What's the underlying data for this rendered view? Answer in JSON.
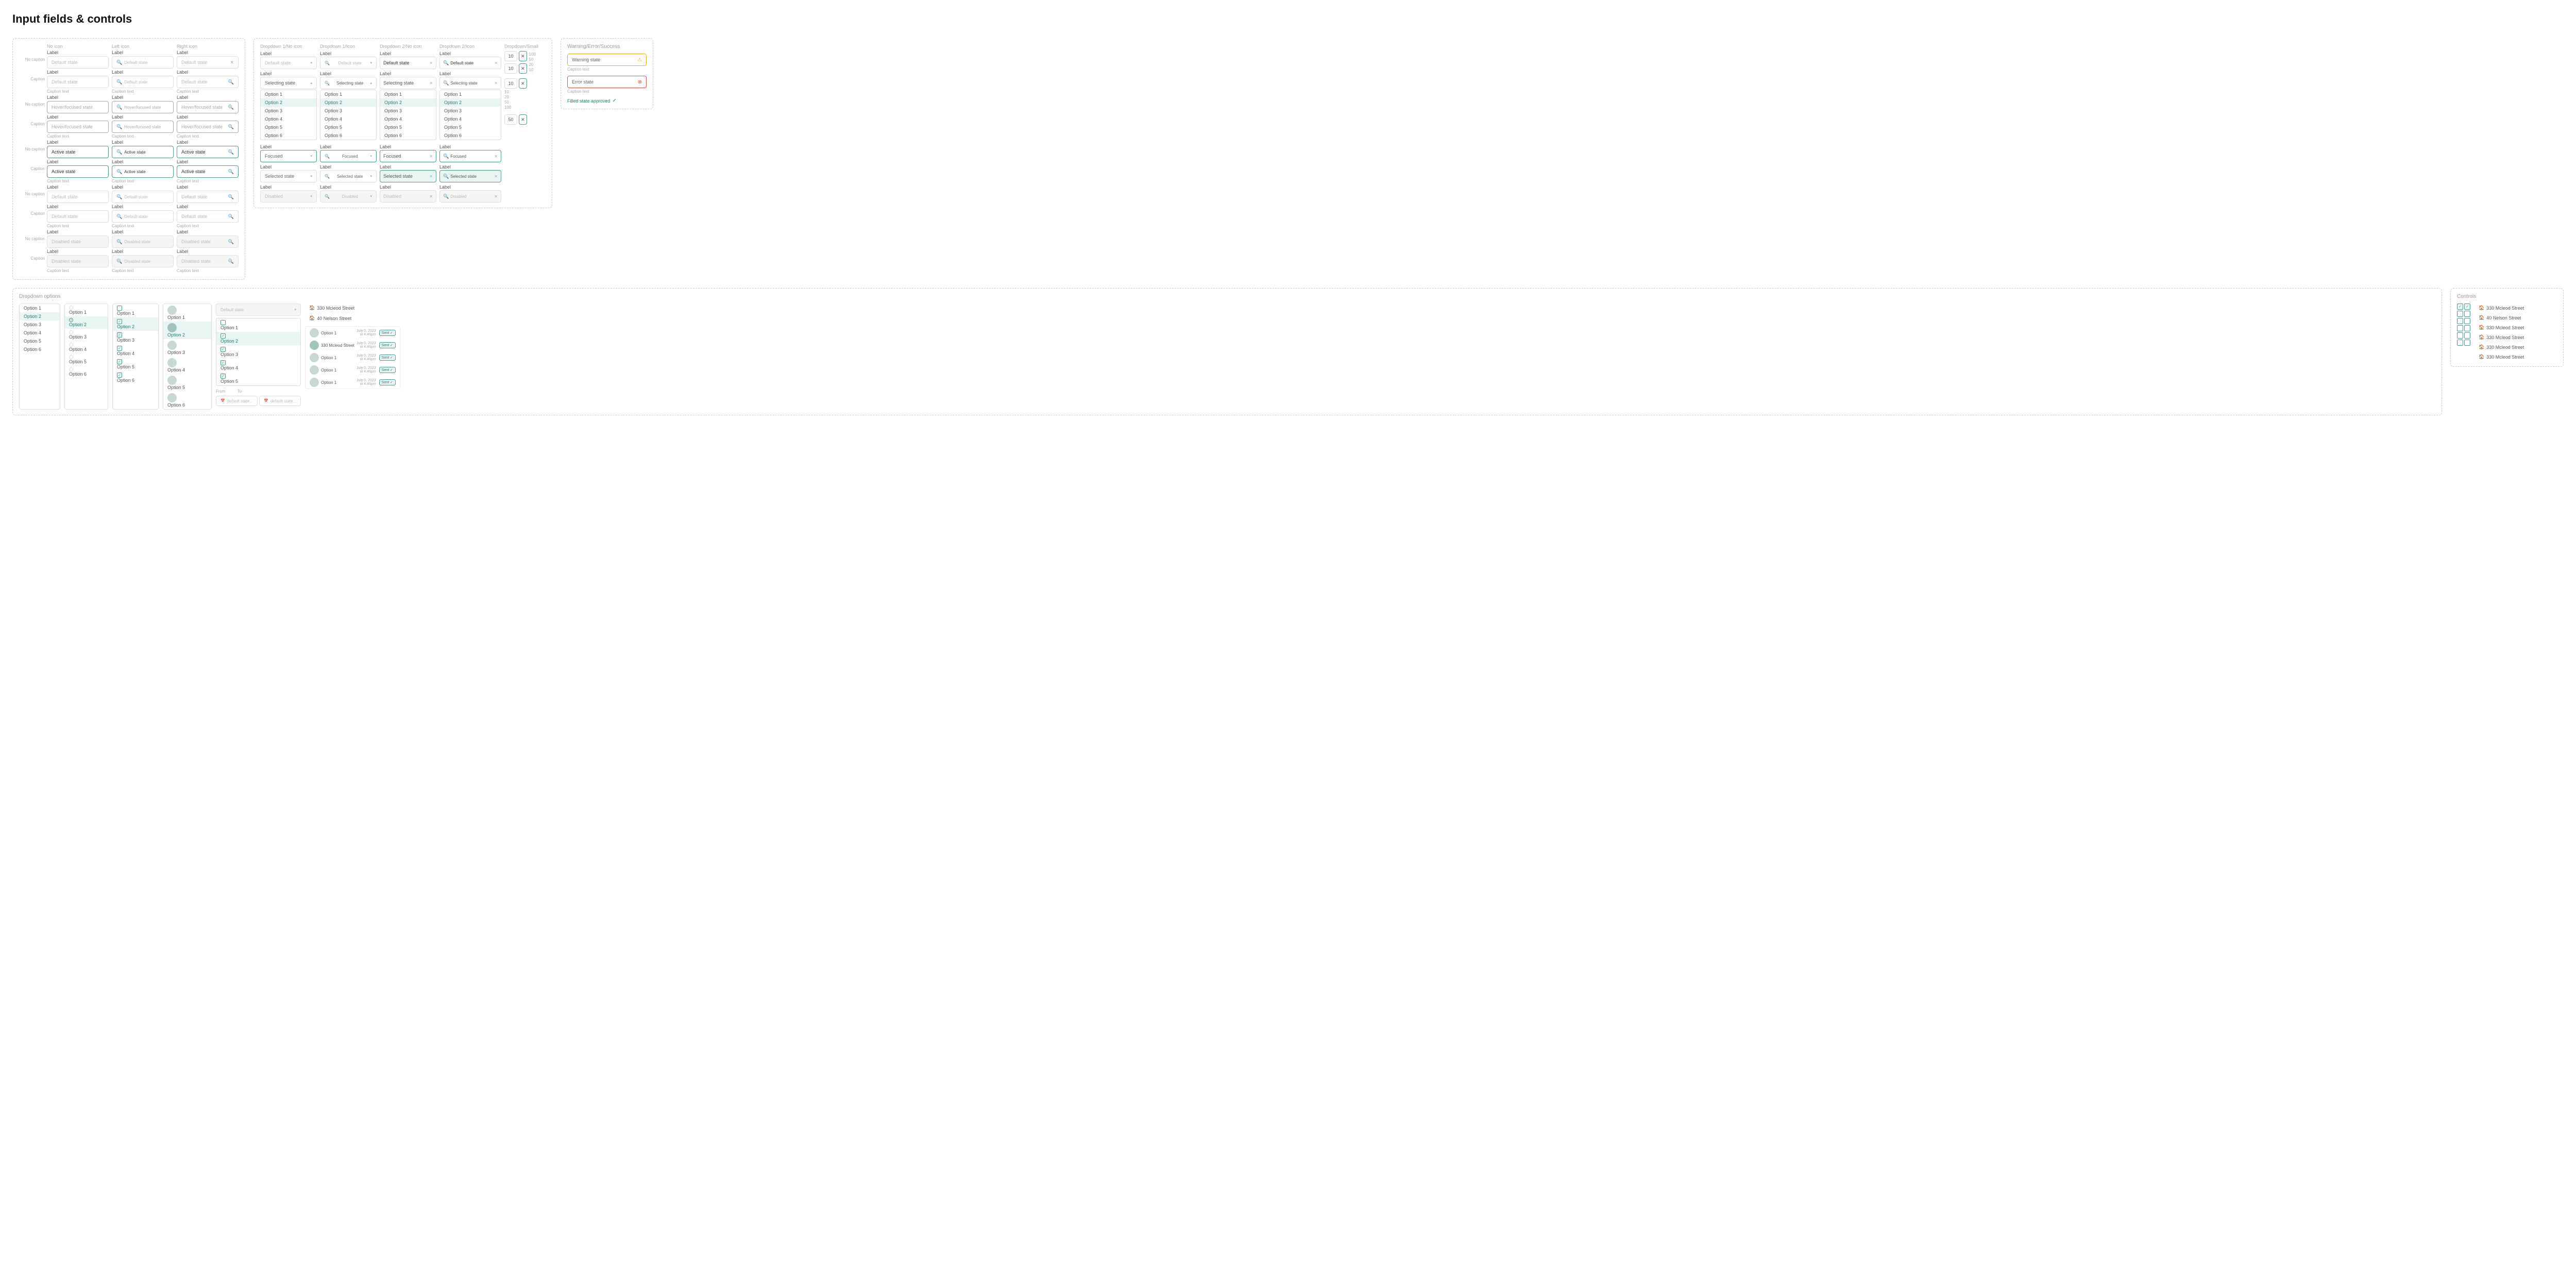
{
  "page": {
    "title": "Input fields & controls"
  },
  "inputSection": {
    "title": "",
    "columns": {
      "noIcon": "No icon",
      "leftIcon": "Left icon",
      "rightIcon": "Right icon"
    },
    "rows": [
      {
        "rowLabel1": "No caption",
        "rowLabel2": "Caption",
        "label": "Label",
        "states": [
          {
            "name": "default",
            "placeholder": "Default state",
            "caption": null
          },
          {
            "name": "hover",
            "placeholder": "Hover/focused state",
            "caption": null
          },
          {
            "name": "active",
            "placeholder": "Active state",
            "caption": null
          },
          {
            "name": "default2",
            "placeholder": "Default state",
            "caption": null
          },
          {
            "name": "disabled",
            "placeholder": "Disabled state",
            "caption": null
          }
        ]
      }
    ],
    "captionText": "Caption text"
  },
  "dropdownSection": {
    "columns": [
      "Dropdown 1/No icon",
      "Dropdown 1/Icon",
      "Dropdown 2/No icon",
      "Dropdown 2/Icon",
      "Dropdown/Small"
    ],
    "states": [
      {
        "label": "Label",
        "value": "Default state",
        "type": "default"
      },
      {
        "label": "Label",
        "value": "Selecting state",
        "type": "selecting"
      },
      {
        "label": "Label",
        "value": "Focused",
        "type": "focused"
      },
      {
        "label": "Label",
        "value": "Selected state",
        "type": "selected"
      },
      {
        "label": "Label",
        "value": "Disabled",
        "type": "disabled"
      }
    ],
    "options": [
      "Option 1",
      "Option 2",
      "Option 3",
      "Option 4",
      "Option 5",
      "Option 6"
    ],
    "smallNumbers": [
      "100",
      "50",
      "20",
      "10",
      "10",
      "20",
      "50",
      "100"
    ]
  },
  "warningSection": {
    "title": "Warning/Error/Success",
    "warning": {
      "label": "Warning state",
      "caption": "Caption text"
    },
    "error": {
      "label": "Error state",
      "caption": "Caption text"
    },
    "success": {
      "label": "Filled state approved"
    }
  },
  "dropdownOptions": {
    "title": "Dropdown options",
    "list1": [
      "Option 1",
      "Option 2",
      "Option 3",
      "Option 4",
      "Option 5",
      "Option 6"
    ],
    "list2": {
      "items": [
        "Option 1",
        "Option 2",
        "Option 3",
        "Option 4",
        "Option 5",
        "Option 6"
      ],
      "selected": 1
    },
    "list3": {
      "items": [
        "Option 1",
        "Option 2",
        "Option 3",
        "Option 4",
        "Option 5",
        "Option 6"
      ],
      "selected": [
        1,
        2,
        3,
        4
      ]
    },
    "addresses1": [
      "330 Mcleod Street",
      "40 Nelson Street"
    ],
    "addresses2": [
      "330 Mcleod Street",
      "330 Mcleod Street",
      "330 Mcleod Street",
      "330 Mcleod Street",
      "330 Mcleod Street"
    ],
    "optionRows": [
      "Option 1",
      "Option 2",
      "Option 3",
      "Option 4",
      "Option 5",
      "Option 6"
    ]
  },
  "controls": {
    "title": "Controls",
    "addresses": [
      "330 Mcleod Street",
      "40 Nelson Street",
      "330 Mcleod Street",
      "330 Mcleod Street",
      "330 Mcleod Street",
      "330 Mcleod Street"
    ]
  }
}
